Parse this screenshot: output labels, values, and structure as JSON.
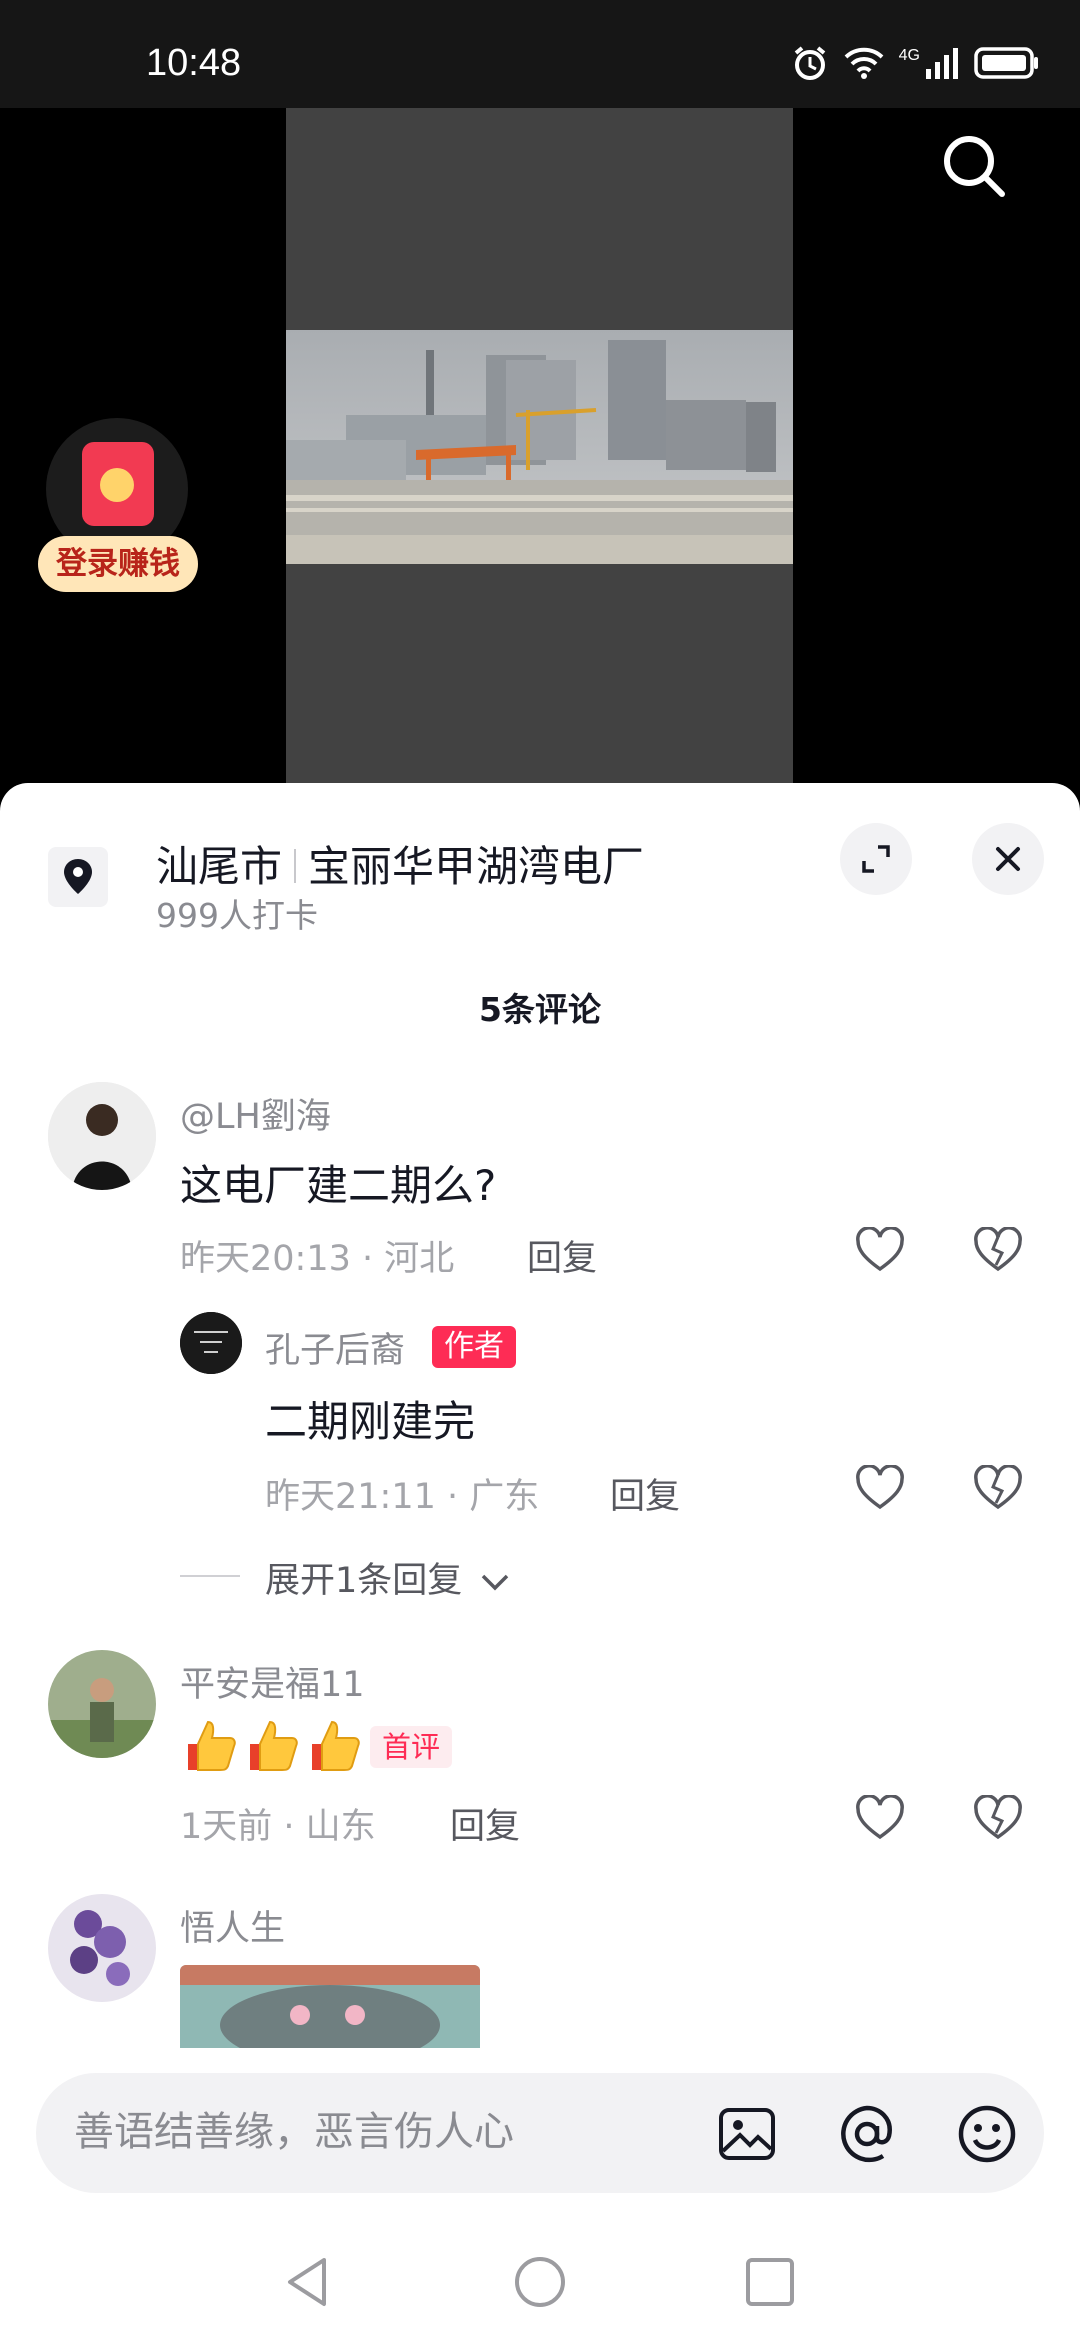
{
  "status_bar": {
    "time": "10:48",
    "network": "4G"
  },
  "redpacket": {
    "label": "登录赚钱"
  },
  "location": {
    "city": "汕尾市",
    "place": "宝丽华甲湖湾电厂",
    "checkins": "999人打卡"
  },
  "comments_header": {
    "count_label": "5条评论"
  },
  "comments": [
    {
      "username": "@LH劉海",
      "text": "这电厂建二期么?",
      "time": "昨天20:13",
      "region": "河北",
      "reply_label": "回复"
    },
    {
      "username": "平安是福11",
      "badge": "首评",
      "time": "1天前",
      "region": "山东",
      "reply_label": "回复"
    },
    {
      "username": "悟人生"
    }
  ],
  "reply": {
    "username": "孔子后裔",
    "badge": "作者",
    "text": "二期刚建完",
    "time": "昨天21:11",
    "region": "广东",
    "reply_label": "回复"
  },
  "expand_replies": {
    "label": "展开1条回复"
  },
  "input": {
    "placeholder": "善语结善缘，恶言伤人心"
  },
  "icons": {
    "search": "search-icon",
    "location": "location-pin-icon",
    "expand": "expand-icon",
    "close": "close-icon",
    "like": "heart-icon",
    "dislike": "broken-heart-icon",
    "image": "image-icon",
    "mention": "at-icon",
    "emoji": "emoji-icon"
  },
  "colors": {
    "accent": "#fe2c55",
    "sheet_bg": "#ffffff",
    "video_bg": "#000000"
  }
}
